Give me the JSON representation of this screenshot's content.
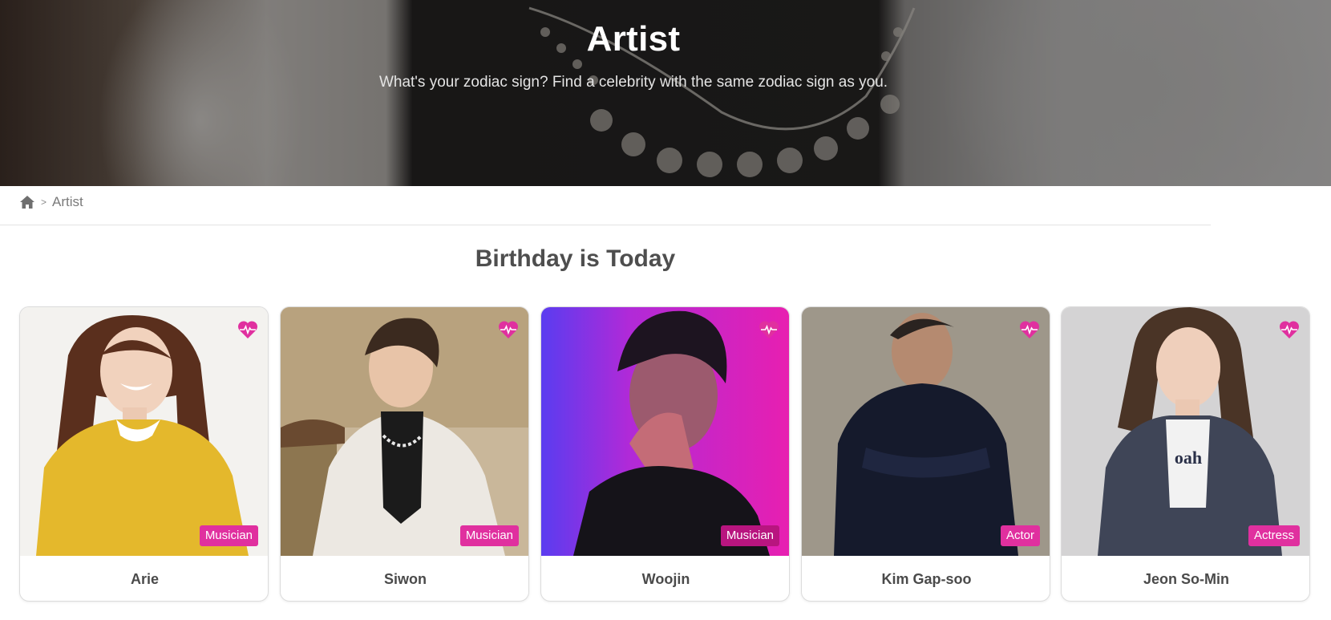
{
  "hero": {
    "title": "Artist",
    "subtitle": "What's your zodiac sign? Find a celebrity with the same zodiac sign as you."
  },
  "breadcrumb": {
    "home_icon": "home-icon",
    "separator": ">",
    "current": "Artist"
  },
  "section": {
    "title": "Birthday is Today"
  },
  "colors": {
    "accent": "#e0309f",
    "text": "#4a4a4a"
  },
  "cards": [
    {
      "name": "Arie",
      "category": "Musician",
      "favorite_icon": "heart-pulse-icon"
    },
    {
      "name": "Siwon",
      "category": "Musician",
      "favorite_icon": "heart-pulse-icon"
    },
    {
      "name": "Woojin",
      "category": "Musician",
      "favorite_icon": "heart-pulse-icon"
    },
    {
      "name": "Kim Gap-soo",
      "category": "Actor",
      "favorite_icon": "heart-pulse-icon"
    },
    {
      "name": "Jeon So-Min",
      "category": "Actress",
      "favorite_icon": "heart-pulse-icon"
    }
  ]
}
